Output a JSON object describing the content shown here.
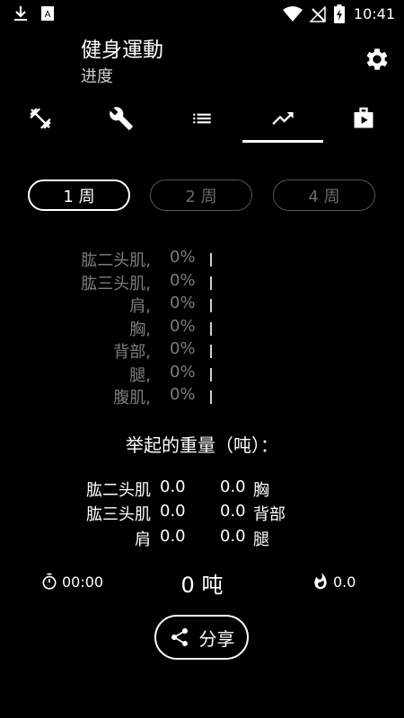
{
  "status_bar": {
    "time": "10:41"
  },
  "header": {
    "title": "健身運動",
    "subtitle": "进度"
  },
  "tabs": [
    {
      "icon": "dumbbell-icon",
      "active": false
    },
    {
      "icon": "wrench-icon",
      "active": false
    },
    {
      "icon": "list-icon",
      "active": false
    },
    {
      "icon": "trending-icon",
      "active": true
    },
    {
      "icon": "video-library-icon",
      "active": false
    }
  ],
  "week_filters": [
    {
      "label": "1 周",
      "active": true
    },
    {
      "label": "2 周",
      "active": false
    },
    {
      "label": "4 周",
      "active": false
    }
  ],
  "muscle_progress": [
    {
      "name": "肱二头肌,",
      "percent": "0%"
    },
    {
      "name": "肱三头肌,",
      "percent": "0%"
    },
    {
      "name": "肩,",
      "percent": "0%"
    },
    {
      "name": "胸,",
      "percent": "0%"
    },
    {
      "name": "背部,",
      "percent": "0%"
    },
    {
      "name": "腿,",
      "percent": "0%"
    },
    {
      "name": "腹肌,",
      "percent": "0%"
    }
  ],
  "weight_lifted": {
    "title": "举起的重量（吨）：",
    "left": [
      {
        "name": "肱二头肌",
        "value": "0.0"
      },
      {
        "name": "肱三头肌",
        "value": "0.0"
      },
      {
        "name": "肩",
        "value": "0.0"
      }
    ],
    "right": [
      {
        "name": "胸",
        "value": "0.0"
      },
      {
        "name": "背部",
        "value": "0.0"
      },
      {
        "name": "腿",
        "value": "0.0"
      }
    ]
  },
  "stats": {
    "duration": "00:00",
    "total": "0 吨",
    "calories": "0.0"
  },
  "share": {
    "label": "分享"
  }
}
